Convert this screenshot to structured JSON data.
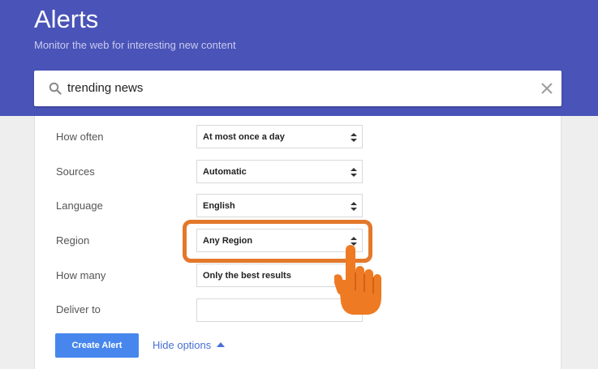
{
  "header": {
    "title": "Alerts",
    "subtitle": "Monitor the web for interesting new content",
    "background_color": "#4a53b7"
  },
  "search": {
    "value": "trending news",
    "icon": "search-icon",
    "clear_icon": "close-icon"
  },
  "options": [
    {
      "label": "How often",
      "value": "At most once a day"
    },
    {
      "label": "Sources",
      "value": "Automatic"
    },
    {
      "label": "Language",
      "value": "English"
    },
    {
      "label": "Region",
      "value": "Any Region",
      "highlighted": true
    },
    {
      "label": "How many",
      "value": "Only the best results"
    },
    {
      "label": "Deliver to",
      "value": ""
    }
  ],
  "actions": {
    "create_label": "Create Alert",
    "hide_options_label": "Hide options",
    "create_color": "#4787ed"
  },
  "annotation": {
    "highlight_color": "#e3782b",
    "pointer": "pointing-hand-icon"
  }
}
